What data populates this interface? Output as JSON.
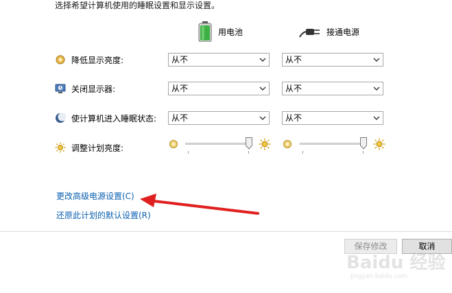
{
  "intro_text": "选择希望计算机使用的睡眠设置和显示设置。",
  "columns": {
    "battery_label": "用电池",
    "plugged_label": "接通电源"
  },
  "rows": [
    {
      "label": "降低显示亮度:",
      "icon": "dim-display-icon",
      "battery": "从不",
      "plugged": "从不"
    },
    {
      "label": "关闭显示器:",
      "icon": "monitor-icon",
      "battery": "从不",
      "plugged": "从不"
    },
    {
      "label": "使计算机进入睡眠状态:",
      "icon": "moon-icon",
      "battery": "从不",
      "plugged": "从不"
    }
  ],
  "brightness": {
    "label": "调整计划亮度:",
    "icon": "sun-icon",
    "battery_level": 1.0,
    "plugged_level": 1.0
  },
  "links": {
    "advanced": "更改高级电源设置(C)",
    "restore": "还原此计划的默认设置(R)"
  },
  "buttons": {
    "save": "保存修改",
    "cancel": "取消"
  },
  "watermark": {
    "brand": "Baidu 经验",
    "url": "jingyan.baidu.com"
  },
  "colors": {
    "link": "#0a5fb0",
    "arrow": "#e02020",
    "battery_green": "#3cb043"
  }
}
